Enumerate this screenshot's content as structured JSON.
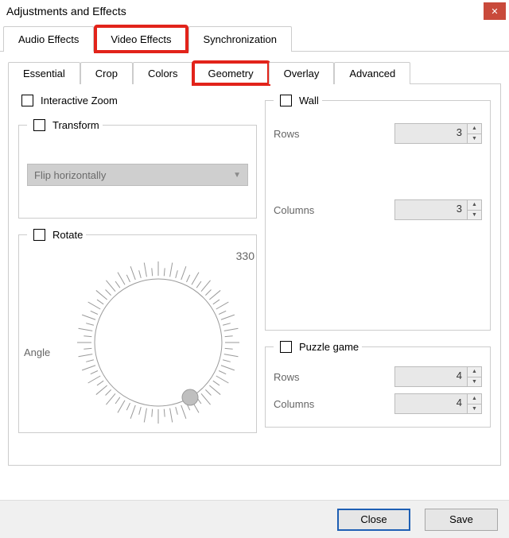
{
  "window": {
    "title": "Adjustments and Effects",
    "close_icon": "✕"
  },
  "main_tabs": {
    "audio": "Audio Effects",
    "video": "Video Effects",
    "sync": "Synchronization",
    "active": "video",
    "highlighted": "video"
  },
  "sub_tabs": {
    "essential": "Essential",
    "crop": "Crop",
    "colors": "Colors",
    "geometry": "Geometry",
    "overlay": "Overlay",
    "advanced": "Advanced",
    "active": "geometry",
    "highlighted": "geometry"
  },
  "geometry": {
    "interactive_zoom": {
      "label": "Interactive Zoom",
      "checked": false
    },
    "transform": {
      "legend": "Transform",
      "checked": false,
      "select_value": "Flip horizontally"
    },
    "rotate": {
      "legend": "Rotate",
      "checked": false,
      "angle_label": "Angle",
      "angle_display": "330",
      "angle_value_deg": 330
    },
    "wall": {
      "legend": "Wall",
      "checked": false,
      "rows_label": "Rows",
      "rows_value": "3",
      "cols_label": "Columns",
      "cols_value": "3"
    },
    "puzzle": {
      "legend": "Puzzle game",
      "checked": false,
      "rows_label": "Rows",
      "rows_value": "4",
      "cols_label": "Columns",
      "cols_value": "4"
    }
  },
  "footer": {
    "close": "Close",
    "save": "Save"
  }
}
